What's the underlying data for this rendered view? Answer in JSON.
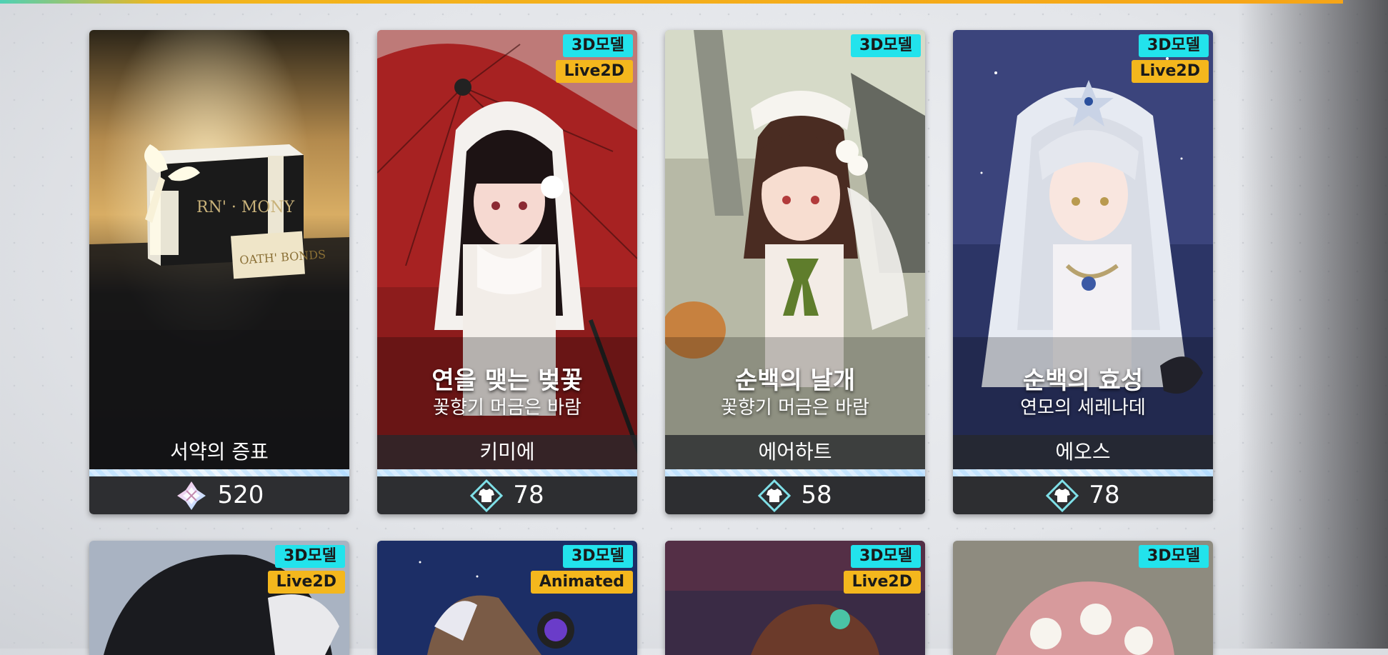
{
  "cards": [
    {
      "badges": [],
      "title": "",
      "subtitle": "",
      "name": "서약의 증표",
      "price": "520",
      "currency_icon": "oath-token-icon",
      "box_text_1": "RN' · MONY",
      "box_text_2": "OATH' BONDS"
    },
    {
      "badges": [
        "3D모델",
        "Live2D"
      ],
      "title": "연을 맺는 벚꽃",
      "subtitle": "꽃향기 머금은 바람",
      "name": "키미에",
      "price": "78",
      "currency_icon": "outfit-shirt-icon"
    },
    {
      "badges": [
        "3D모델"
      ],
      "title": "순백의 날개",
      "subtitle": "꽃향기 머금은 바람",
      "name": "에어하트",
      "price": "58",
      "currency_icon": "outfit-shirt-icon"
    },
    {
      "badges": [
        "3D모델",
        "Live2D"
      ],
      "title": "순백의 효성",
      "subtitle": "연모의 세레나데",
      "name": "에오스",
      "price": "78",
      "currency_icon": "outfit-shirt-icon"
    }
  ],
  "row2": [
    {
      "badges": [
        "3D모델",
        "Live2D"
      ]
    },
    {
      "badges": [
        "3D모델",
        "Animated"
      ]
    },
    {
      "badges": [
        "3D모델",
        "Live2D"
      ]
    },
    {
      "badges": [
        "3D모델"
      ]
    }
  ],
  "colors": {
    "badge_3d": "#22e3ec",
    "badge_live2d": "#f4b71d",
    "accent_bar": "#f6a517"
  }
}
